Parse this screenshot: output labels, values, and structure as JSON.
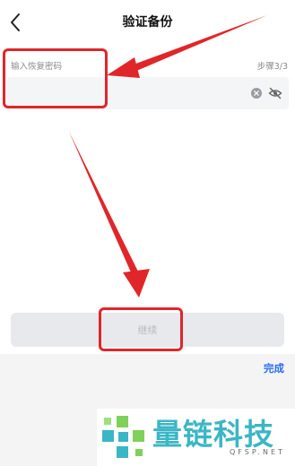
{
  "header": {
    "title": "验证备份",
    "back_icon": "chevron-left-icon"
  },
  "form": {
    "label": "输入恢复密码",
    "step": "步骤3/3",
    "input_value": "",
    "icons": [
      "clear-icon",
      "eye-off-icon"
    ]
  },
  "actions": {
    "continue_label": "继续",
    "done_label": "完成"
  },
  "colors": {
    "accent": "#2c6cf6",
    "annotation": "#e0262a",
    "watermark": "#3bb6c5"
  },
  "watermark": {
    "name": "量链科技",
    "domain": "QFSP.NET"
  }
}
